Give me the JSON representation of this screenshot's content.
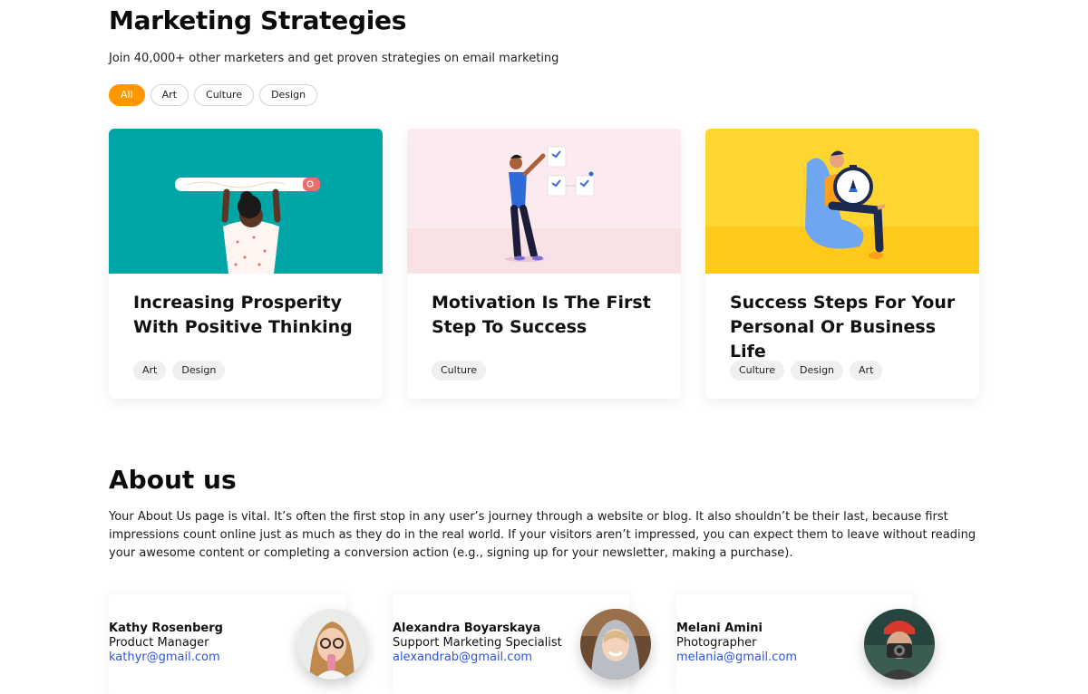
{
  "header": {
    "title": "Marketing Strategies",
    "subtitle": "Join 40,000+ other marketers and get proven strategies on email marketing"
  },
  "filters": [
    {
      "label": "All",
      "active": true
    },
    {
      "label": "Art",
      "active": false
    },
    {
      "label": "Culture",
      "active": false
    },
    {
      "label": "Design",
      "active": false
    }
  ],
  "cards": [
    {
      "title": "Increasing Prosperity With Positive Thinking",
      "tags": [
        "Art",
        "Design"
      ],
      "bg": "#00a6a6"
    },
    {
      "title": "Motivation Is The First Step To Success",
      "tags": [
        "Culture"
      ],
      "bg": "#fbe9ec"
    },
    {
      "title": "Success Steps For Your Personal Or Business Life",
      "tags": [
        "Culture",
        "Design",
        "Art"
      ],
      "bg": "#ffd531"
    }
  ],
  "about": {
    "title": "About us",
    "text": "Your About Us page is vital. It’s often the first stop in any user’s journey through a website or blog. It also shouldn’t be their last, because first impressions count online just as much as they do in the real world. If your visitors aren’t impressed, you can expect them to leave without reading your awesome content or completing a conversion action (e.g., signing up for your newsletter, making a purchase)."
  },
  "team": [
    {
      "name": "Kathy Rosenberg",
      "role": "Product Manager",
      "email": "kathyr@gmail.com"
    },
    {
      "name": "Alexandra Boyarskaya",
      "role": "Support Marketing Specialist",
      "email": "alexandrab@gmail.com"
    },
    {
      "name": "Melani Amini",
      "role": "Photographer",
      "email": "melania@gmail.com"
    }
  ],
  "colors": {
    "accent": "#ff9800",
    "link": "#2d55d8"
  }
}
